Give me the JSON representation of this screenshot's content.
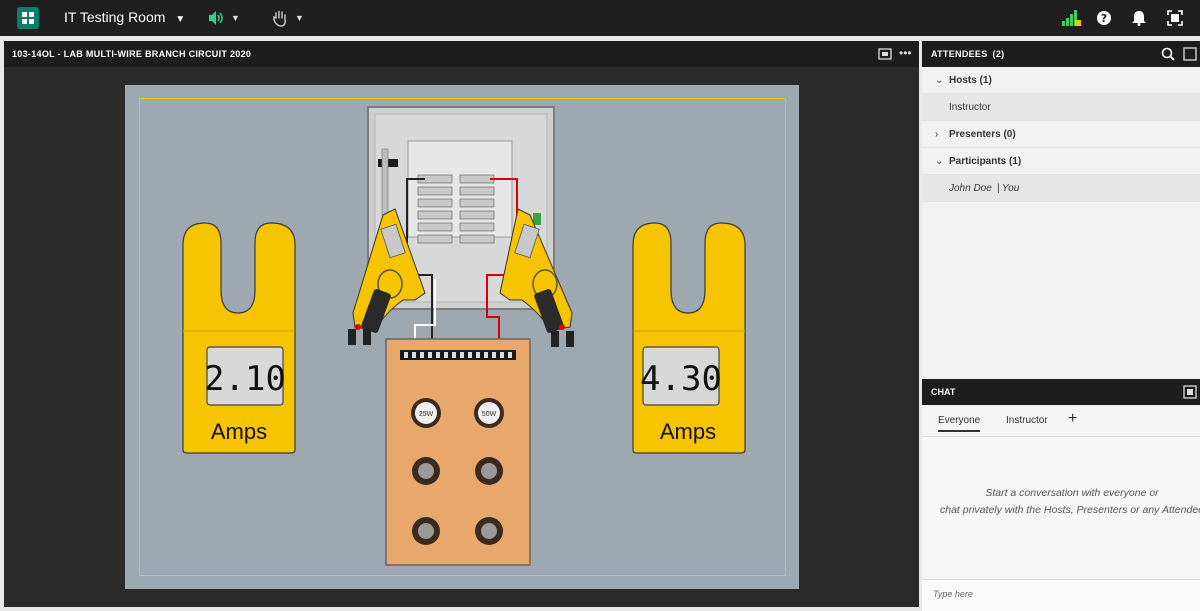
{
  "app": {
    "room_title": "IT Testing Room",
    "icons": [
      "app-logo-icon",
      "speaker-icon",
      "hand-raise-icon",
      "signal-icon",
      "help-icon",
      "bell-icon",
      "fullscreen-icon"
    ]
  },
  "pod": {
    "title": "103-14OL - LAB MULTI-WIRE BRANCH CIRCUIT 2020",
    "more": "•••"
  },
  "lab": {
    "meter_left_reading": "2.10",
    "meter_left_unit": "Amps",
    "meter_right_reading": "4.30",
    "meter_right_unit": "Amps",
    "bulb_1_label": "25W",
    "bulb_2_label": "50W",
    "colors": {
      "meter_yellow": "#f6c400",
      "panel_gray": "#d8d8d8",
      "board_orange": "#e8a86c",
      "stage_bg": "#9ea8b1"
    }
  },
  "attendees": {
    "title": "ATTENDEES",
    "count": "(2)",
    "hosts_label": "Hosts (1)",
    "host_name": "Instructor",
    "presenters_label": "Presenters (0)",
    "participants_label": "Participants (1)",
    "participant_name": "John Doe",
    "participant_you": "| You"
  },
  "chat": {
    "title": "CHAT",
    "tab_everyone": "Everyone",
    "tab_instructor": "Instructor",
    "add_tab": "+",
    "empty_line1": "Start a conversation with everyone or",
    "empty_line2": "chat privately with the Hosts, Presenters or any Attendee",
    "input_placeholder": "Type here"
  }
}
